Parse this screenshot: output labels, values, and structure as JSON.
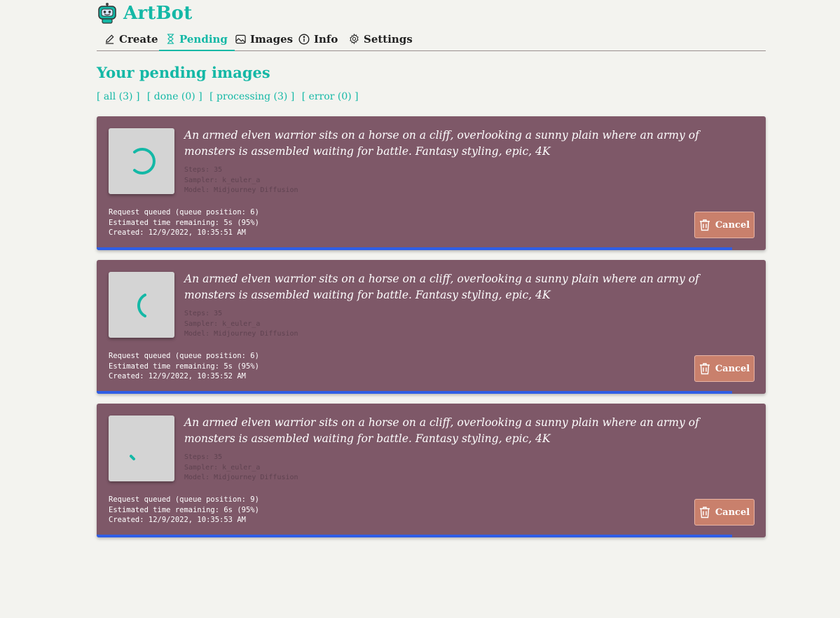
{
  "app": {
    "title": "ArtBot"
  },
  "nav": {
    "items": [
      {
        "label": "Create",
        "icon": "pencil-icon"
      },
      {
        "label": "Pending",
        "icon": "hourglass-icon",
        "active": true
      },
      {
        "label": "Images",
        "icon": "image-icon"
      },
      {
        "label": "Info",
        "icon": "info-icon"
      },
      {
        "label": "Settings",
        "icon": "gear-icon"
      }
    ]
  },
  "page": {
    "title": "Your pending images"
  },
  "filters": [
    "[ all (3) ]",
    "[ done (0) ]",
    "[ processing (3) ]",
    "[ error (0) ]"
  ],
  "jobs": [
    {
      "prompt": "An armed elven warrior sits on a horse on a cliff, overlooking a sunny plain where an army of monsters is assembled waiting for battle. Fantasy styling, epic, 4K",
      "steps": "Steps: 35",
      "sampler": "Sampler: k_euler_a",
      "model": "Model: Midjourney Diffusion",
      "queue": "Request queued (queue position: 6)",
      "eta": "Estimated time remaining: 5s (95%)",
      "created": "Created: 12/9/2022, 10:35:51 AM",
      "cancel_label": "Cancel",
      "progress": 0.95
    },
    {
      "prompt": "An armed elven warrior sits on a horse on a cliff, overlooking a sunny plain where an army of monsters is assembled waiting for battle. Fantasy styling, epic, 4K",
      "steps": "Steps: 35",
      "sampler": "Sampler: k_euler_a",
      "model": "Model: Midjourney Diffusion",
      "queue": "Request queued (queue position: 6)",
      "eta": "Estimated time remaining: 5s (95%)",
      "created": "Created: 12/9/2022, 10:35:52 AM",
      "cancel_label": "Cancel",
      "progress": 0.95
    },
    {
      "prompt": "An armed elven warrior sits on a horse on a cliff, overlooking a sunny plain where an army of monsters is assembled waiting for battle. Fantasy styling, epic, 4K",
      "steps": "Steps: 35",
      "sampler": "Sampler: k_euler_a",
      "model": "Model: Midjourney Diffusion",
      "queue": "Request queued (queue position: 9)",
      "eta": "Estimated time remaining: 6s (95%)",
      "created": "Created: 12/9/2022, 10:35:53 AM",
      "cancel_label": "Cancel",
      "progress": 0.95
    }
  ],
  "colors": {
    "accent": "#14b8a6",
    "card": "#7e5868",
    "cancel": "#c9806c",
    "progress": "#2f5ee5",
    "background": "#f3f3ef"
  }
}
